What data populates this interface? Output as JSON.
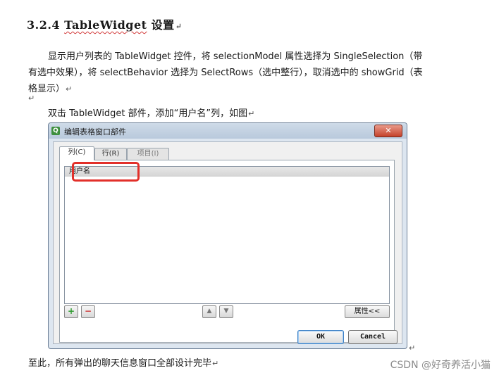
{
  "heading": {
    "number": "3.2.4",
    "title_word": "TableWidget",
    "title_rest": "设置"
  },
  "pilcrow": "↵",
  "para1": {
    "line1": "显示用户列表的 TableWidget 控件，将 selectionModel 属性选择为  SingleSelection（带",
    "line2": "有选中效果），将 selectBehavior 选择为  SelectRows（选中整行），取消选中的 showGrid（表",
    "line3": "格显示）"
  },
  "para2": "双击 TableWidget 部件，添加“用户名”列，如图",
  "dialog": {
    "title": "编辑表格窗口部件",
    "close_label": "✕",
    "tabs": [
      "列(C)",
      "行(R)",
      "项目(I)"
    ],
    "column_item": "用户名",
    "add_label": "+",
    "remove_label": "−",
    "up_label": "▲",
    "down_label": "▼",
    "properties_label": "属性<<",
    "ok_label": "OK",
    "cancel_label": "Cancel"
  },
  "para_end": "至此，所有弹出的聊天信息窗口全部设计完毕",
  "watermark": "CSDN @好奇养活小猫",
  "colors": {
    "highlight": "#e2302a",
    "titlebar": "#b9c9dc"
  }
}
